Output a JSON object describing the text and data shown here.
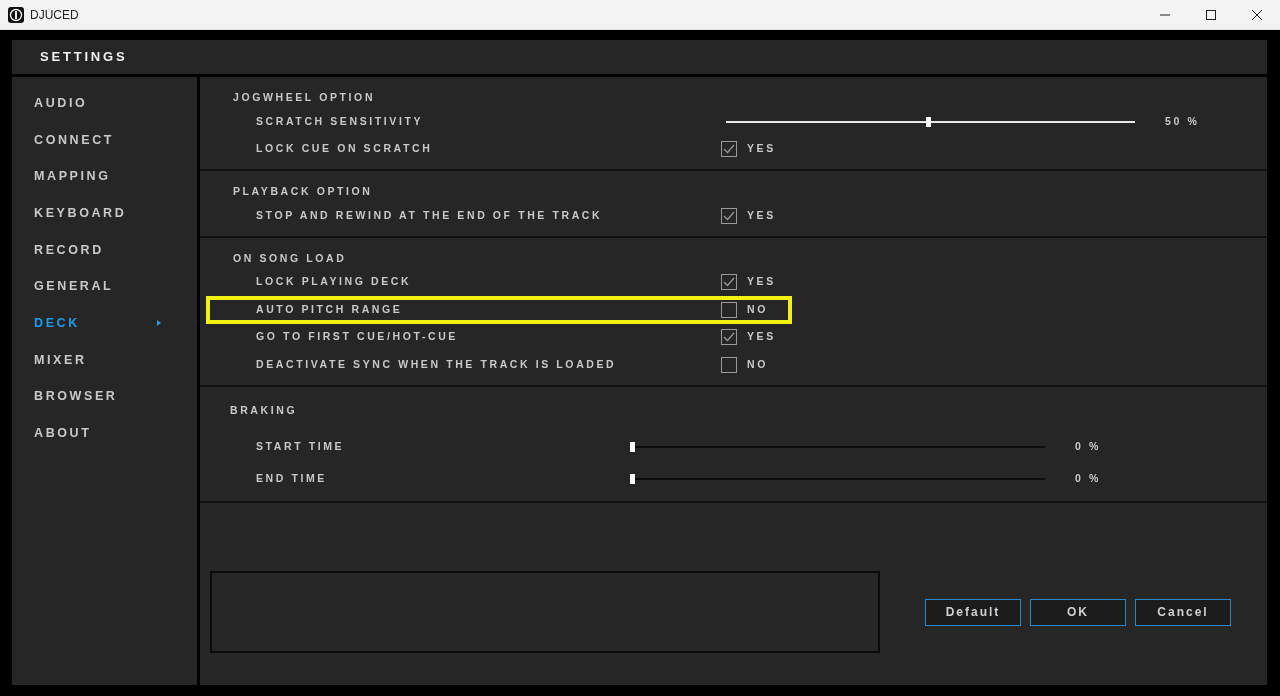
{
  "window": {
    "title": "DJUCED"
  },
  "header": {
    "title": "SETTINGS"
  },
  "sidebar": {
    "items": [
      {
        "label": "AUDIO",
        "selected": false
      },
      {
        "label": "CONNECT",
        "selected": false
      },
      {
        "label": "MAPPING",
        "selected": false
      },
      {
        "label": "KEYBOARD",
        "selected": false
      },
      {
        "label": "RECORD",
        "selected": false
      },
      {
        "label": "GENERAL",
        "selected": false
      },
      {
        "label": "DECK",
        "selected": true
      },
      {
        "label": "MIXER",
        "selected": false
      },
      {
        "label": "BROWSER",
        "selected": false
      },
      {
        "label": "ABOUT",
        "selected": false
      }
    ]
  },
  "sections": [
    {
      "title": "JOGWHEEL OPTION",
      "rows": [
        {
          "kind": "slider",
          "label": "SCRATCH SENSITIVITY",
          "level": 0.5,
          "reading": "50 %",
          "highlighted": false
        },
        {
          "kind": "checkbox",
          "label": "LOCK CUE ON SCRATCH",
          "checked": true,
          "value": "YES",
          "highlighted": false
        }
      ]
    },
    {
      "title": "PLAYBACK OPTION",
      "rows": [
        {
          "kind": "checkbox",
          "label": "STOP AND REWIND AT THE END OF THE TRACK",
          "checked": true,
          "value": "YES",
          "highlighted": false
        }
      ]
    },
    {
      "title": "ON SONG LOAD",
      "rows": [
        {
          "kind": "checkbox",
          "label": "LOCK PLAYING DECK",
          "checked": true,
          "value": "YES",
          "highlighted": false
        },
        {
          "kind": "checkbox",
          "label": "AUTO PITCH RANGE",
          "checked": false,
          "value": "NO",
          "highlighted": true
        },
        {
          "kind": "checkbox",
          "label": "GO TO FIRST CUE/HOT-CUE",
          "checked": true,
          "value": "YES",
          "highlighted": false
        },
        {
          "kind": "checkbox",
          "label": "DEACTIVATE SYNC WHEN THE TRACK IS LOADED",
          "checked": false,
          "value": "NO",
          "highlighted": false
        }
      ]
    },
    {
      "title": "BRAKING",
      "rows": [
        {
          "kind": "slider",
          "label": "START TIME",
          "level": 0,
          "reading": "0 %",
          "highlighted": false
        },
        {
          "kind": "slider",
          "label": "END TIME",
          "level": 0,
          "reading": "0 %",
          "highlighted": false
        }
      ]
    }
  ],
  "buttons": [
    "Default",
    "OK",
    "Cancel"
  ]
}
